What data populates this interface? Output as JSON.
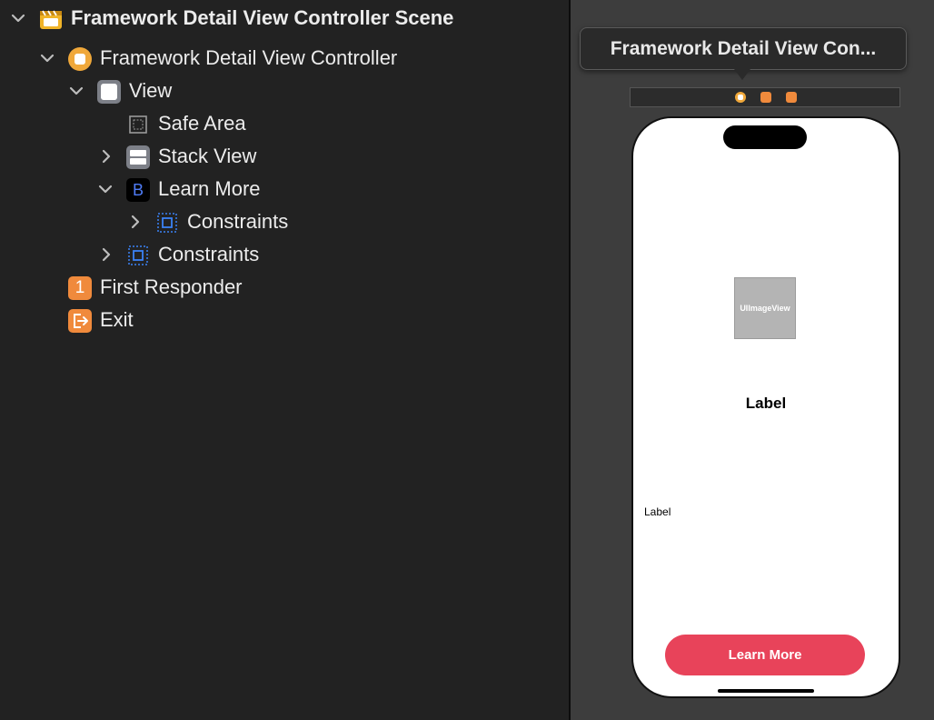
{
  "outline": {
    "rows": [
      {
        "label": "Framework Detail View Controller Scene",
        "icon": "scene-icon",
        "expanded": true
      },
      {
        "label": "Framework Detail View Controller",
        "icon": "view-controller-icon",
        "expanded": true
      },
      {
        "label": "View",
        "icon": "view-icon",
        "expanded": true
      },
      {
        "label": "Safe Area",
        "icon": "safe-area-icon"
      },
      {
        "label": "Stack View",
        "icon": "stack-view-icon",
        "expanded": false
      },
      {
        "label": "Learn More",
        "icon": "button-icon",
        "icon_glyph": "B",
        "expanded": true
      },
      {
        "label": "Constraints",
        "icon": "constraints-icon",
        "expanded": false
      },
      {
        "label": "Constraints",
        "icon": "constraints-icon",
        "expanded": false
      },
      {
        "label": "First Responder",
        "icon": "first-responder-icon",
        "icon_glyph": "1"
      },
      {
        "label": "Exit",
        "icon": "exit-icon"
      }
    ]
  },
  "canvas": {
    "scene_title": "Framework Detail View Con...",
    "dock_icons": [
      "view-controller-icon",
      "first-responder-icon",
      "exit-icon"
    ],
    "phone": {
      "image_view_text": "UIImageView",
      "title_label": "Label",
      "description_label": "Label",
      "button_label": "Learn More"
    }
  },
  "colors": {
    "accent_orange": "#f08a3c",
    "scene_yellow": "#f0b429",
    "button_red": "#e8435a"
  }
}
